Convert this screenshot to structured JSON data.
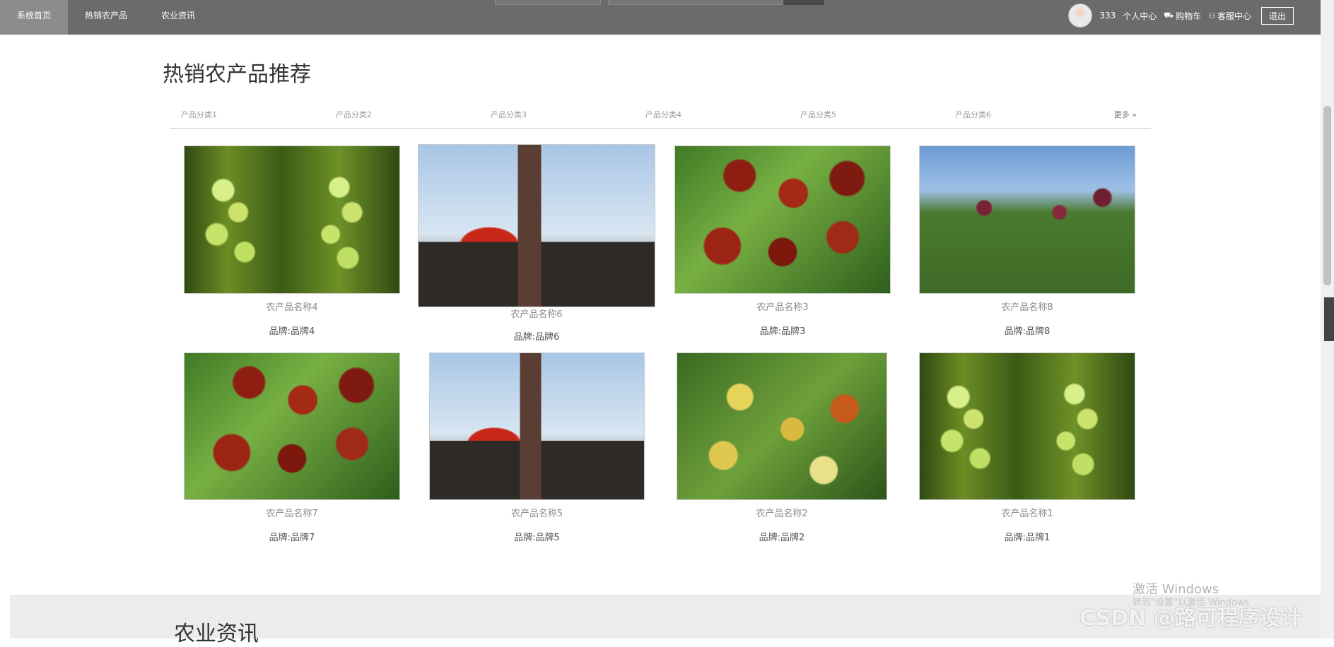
{
  "nav": {
    "items": [
      {
        "label": "系统首页"
      },
      {
        "label": "热销农产品"
      },
      {
        "label": "农业资讯"
      }
    ]
  },
  "user": {
    "name": "333",
    "personal_center": "个人中心",
    "cart": "购物车",
    "service": "客服中心",
    "logout": "退出"
  },
  "section": {
    "title": "热销农产品推荐",
    "categories": [
      "产品分类1",
      "产品分类2",
      "产品分类3",
      "产品分类4",
      "产品分类5",
      "产品分类6"
    ],
    "more": "更多 »"
  },
  "products": [
    {
      "name": "农产品名称4",
      "brand": "品牌:品牌4",
      "image": "green-grapes"
    },
    {
      "name": "农产品名称6",
      "brand": "品牌:品牌6",
      "image": "farmer-dates"
    },
    {
      "name": "农产品名称3",
      "brand": "品牌:品牌3",
      "image": "red-dates"
    },
    {
      "name": "农产品名称8",
      "brand": "品牌:品牌8",
      "image": "date-field"
    },
    {
      "name": "农产品名称7",
      "brand": "品牌:品牌7",
      "image": "red-dates"
    },
    {
      "name": "农产品名称5",
      "brand": "品牌:品牌5",
      "image": "farmer-dates"
    },
    {
      "name": "农产品名称2",
      "brand": "品牌:品牌2",
      "image": "yellow-dates"
    },
    {
      "name": "农产品名称1",
      "brand": "品牌:品牌1",
      "image": "green-grapes"
    }
  ],
  "next_section": {
    "title": "农业资讯"
  },
  "watermark": {
    "windows": "激活 Windows",
    "windows_sub": "转到\"设置\"以激活 Windows",
    "csdn": "CSDN @路可程序设计"
  }
}
